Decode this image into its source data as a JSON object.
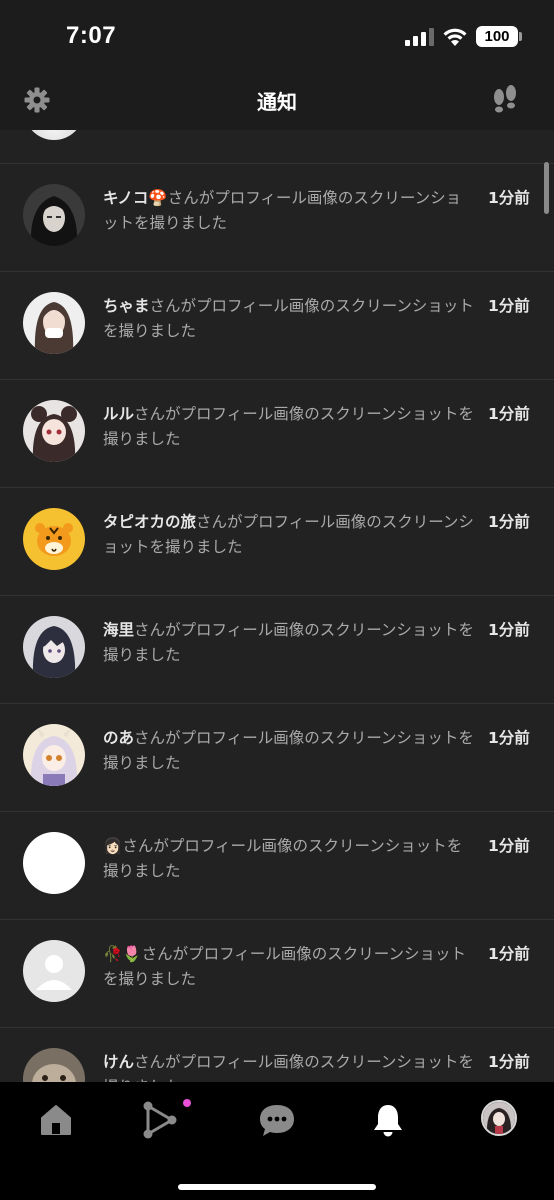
{
  "status_bar": {
    "time": "7:07",
    "battery": "100"
  },
  "header": {
    "title": "通知"
  },
  "notifications": [
    {
      "username": "キノコ",
      "username_emoji": "🍄",
      "message": "さんがプロフィール画像のスクリーンショットを撮りました",
      "time": "1分前",
      "avatar": "dark-hair-person"
    },
    {
      "username": "ちゃま",
      "message": "さんがプロフィール画像のスクリーンショットを撮りました",
      "time": "1分前",
      "avatar": "long-hair-person"
    },
    {
      "username": "ルル",
      "message": "さんがプロフィール画像のスクリーンショットを撮りました",
      "time": "1分前",
      "avatar": "anime-girl"
    },
    {
      "username": "タピオカの旅",
      "message": "さんがプロフィール画像のスクリーンショットを撮りました",
      "time": "1分前",
      "avatar": "tiger-emoji"
    },
    {
      "username": "海里",
      "message": "さんがプロフィール画像のスクリーンショットを撮りました",
      "time": "1分前",
      "avatar": "anime-boy"
    },
    {
      "username": "のあ",
      "message": "さんがプロフィール画像のスクリーンショットを撮りました",
      "time": "1分前",
      "avatar": "anime-dragon-girl"
    },
    {
      "username": "",
      "username_emoji": "👩🏻",
      "message": "さんがプロフィール画像のスクリーンショットを撮りました",
      "time": "1分前",
      "avatar": "white-circle"
    },
    {
      "username": "",
      "username_emoji": "🥀🌷",
      "message": "さんがプロフィール画像のスクリーンショットを撮りました",
      "time": "1分前",
      "avatar": "default-person"
    },
    {
      "username": "けん",
      "message": "さんがプロフィール画像のスクリーンショットを撮りました",
      "time": "1分前",
      "avatar": "cat-photo"
    }
  ],
  "tabs": [
    {
      "name": "home",
      "icon": "home-icon",
      "active": false
    },
    {
      "name": "share",
      "icon": "share-network-icon",
      "active": false,
      "badge": true
    },
    {
      "name": "chat",
      "icon": "chat-bubble-icon",
      "active": false
    },
    {
      "name": "notifications",
      "icon": "bell-icon",
      "active": true
    },
    {
      "name": "profile",
      "icon": "profile-avatar",
      "active": false
    }
  ],
  "colors": {
    "background": "#222222",
    "header": "#1c1c1c",
    "badge": "#e94fd8",
    "tiger_bg": "#f5c130"
  }
}
